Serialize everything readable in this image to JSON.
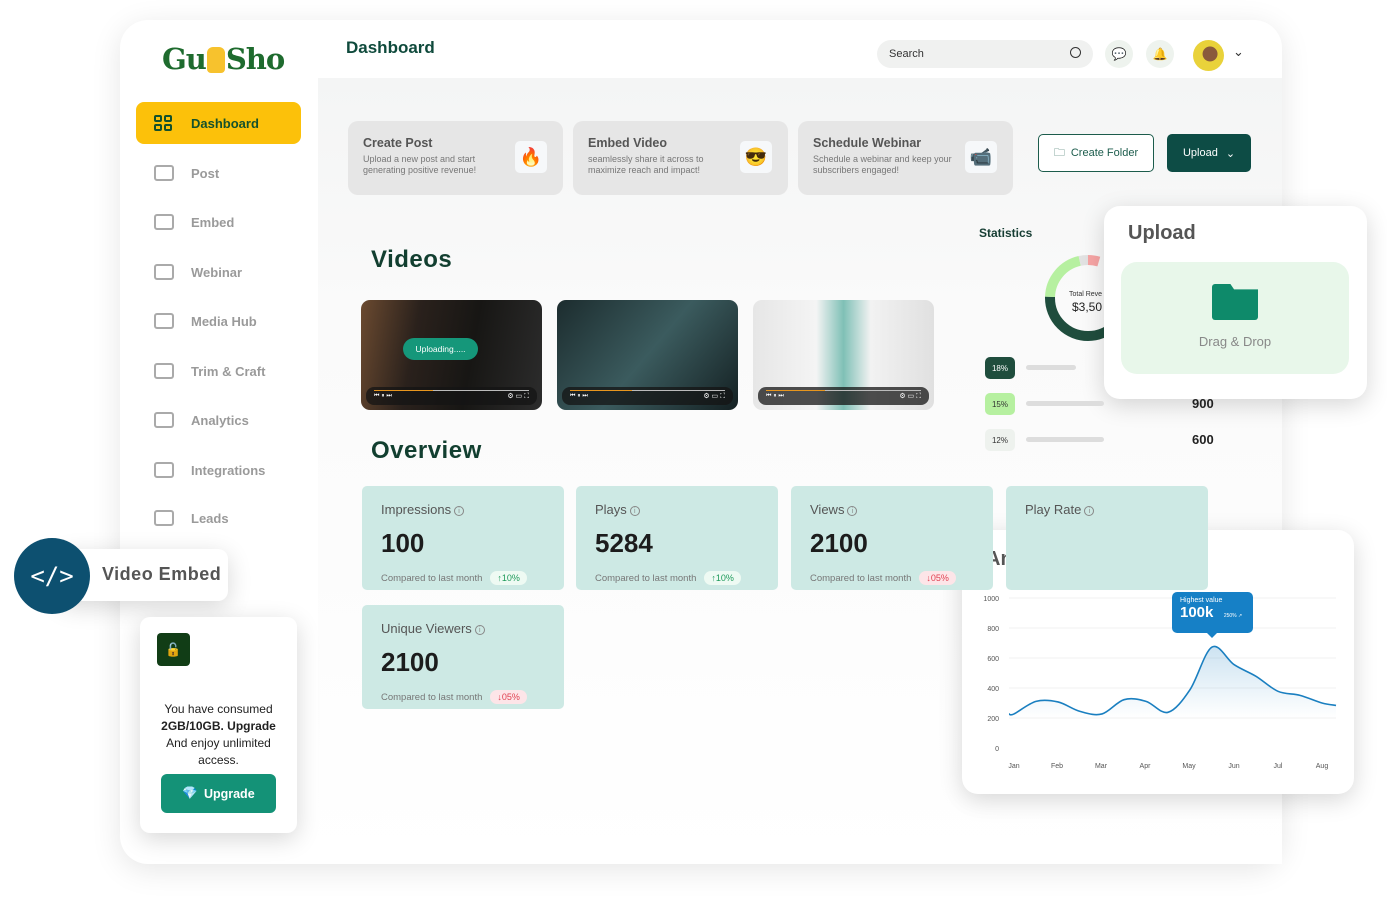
{
  "brand": {
    "logo": "GuSho"
  },
  "sidebar": {
    "items": [
      {
        "label": "Dashboard",
        "icon": "grid-icon",
        "active": true
      },
      {
        "label": "Post",
        "icon": "card-icon"
      },
      {
        "label": "Embed",
        "icon": "arrows-icon"
      },
      {
        "label": "Webinar",
        "icon": "screen-icon"
      },
      {
        "label": "Media Hub",
        "icon": "media-icon"
      },
      {
        "label": "Trim & Craft",
        "icon": "trim-icon"
      },
      {
        "label": "Analytics",
        "icon": "analytics-icon"
      },
      {
        "label": "Integrations",
        "icon": "integrations-icon"
      },
      {
        "label": "Leads",
        "icon": "user-icon"
      }
    ]
  },
  "video_embed_badge": {
    "label": "Video Embed",
    "icon": "code-icon"
  },
  "upgrade_card": {
    "line1": "You have consumed",
    "line2": "2GB/10GB. Upgrade",
    "line3": "And enjoy unlimited access.",
    "button": "Upgrade"
  },
  "header": {
    "title": "Dashboard",
    "search_placeholder": "Search"
  },
  "actions": [
    {
      "title": "Create Post",
      "desc": "Upload a new post and start generating positive revenue!",
      "icon": "🔥"
    },
    {
      "title": "Embed Video",
      "desc": "seamlessly share it across to maximize reach and impact!",
      "icon": "😎"
    },
    {
      "title": "Schedule Webinar",
      "desc": "Schedule a webinar and keep your subscribers engaged!",
      "icon": "📹"
    }
  ],
  "buttons": {
    "create_folder": "Create Folder",
    "upload": "Upload"
  },
  "videos": {
    "title": "Videos",
    "uploading": "Uploading.....",
    "progress": [
      0.38,
      0.4,
      0.38
    ]
  },
  "overview": {
    "title": "Overview",
    "compare": "Compared to last month",
    "stats": [
      {
        "name": "Impressions",
        "value": "100",
        "change": "↑10%",
        "dir": "up"
      },
      {
        "name": "Plays",
        "value": "5284",
        "change": "↑10%",
        "dir": "up"
      },
      {
        "name": "Views",
        "value": "2100",
        "change": "↓05%",
        "dir": "down"
      },
      {
        "name": "Play Rate",
        "value": "",
        "change": "",
        "dir": ""
      },
      {
        "name": "Unique Viewers",
        "value": "2100",
        "change": "↓05%",
        "dir": "down"
      }
    ]
  },
  "statistics": {
    "title": "Statistics",
    "center_label": "Total Reve",
    "center_value": "$3,50",
    "rows": [
      {
        "pct": "18%",
        "value": "",
        "color": "#1f4d3d"
      },
      {
        "pct": "15%",
        "value": "900",
        "color": "#b6f0a0"
      },
      {
        "pct": "12%",
        "value": "600",
        "color": "#eef2ee"
      }
    ]
  },
  "upload_card": {
    "title": "Upload",
    "drop": "Drag & Drop"
  },
  "chart_data": {
    "type": "area",
    "title": "Analytics",
    "x": [
      "Jan",
      "",
      "Feb",
      "",
      "Mar",
      "",
      "Apr",
      "",
      "May",
      "",
      "Jun",
      "",
      "Jul",
      "",
      "Aug"
    ],
    "values": [
      227,
      311,
      307,
      244,
      227,
      322,
      311,
      238,
      389,
      673,
      556,
      478,
      378,
      351,
      300
    ],
    "xticks": [
      "Jan",
      "Feb",
      "Mar",
      "Apr",
      "May",
      "Jun",
      "Jul",
      "Aug"
    ],
    "yticks": [
      "1000",
      "800",
      "600",
      "400",
      "200",
      "0"
    ],
    "ylim": [
      0,
      1000
    ],
    "color": "#1a7fc0",
    "tooltip": {
      "label": "Highest value",
      "value": "100k",
      "change": "250% ↗"
    }
  }
}
